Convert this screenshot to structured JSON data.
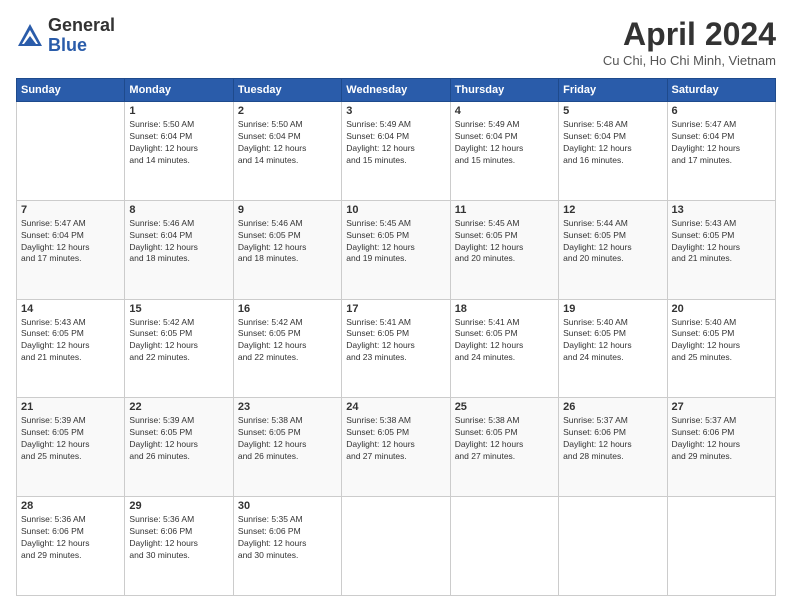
{
  "logo": {
    "general": "General",
    "blue": "Blue"
  },
  "title": "April 2024",
  "location": "Cu Chi, Ho Chi Minh, Vietnam",
  "weekdays": [
    "Sunday",
    "Monday",
    "Tuesday",
    "Wednesday",
    "Thursday",
    "Friday",
    "Saturday"
  ],
  "weeks": [
    [
      {
        "day": "",
        "info": ""
      },
      {
        "day": "1",
        "info": "Sunrise: 5:50 AM\nSunset: 6:04 PM\nDaylight: 12 hours\nand 14 minutes."
      },
      {
        "day": "2",
        "info": "Sunrise: 5:50 AM\nSunset: 6:04 PM\nDaylight: 12 hours\nand 14 minutes."
      },
      {
        "day": "3",
        "info": "Sunrise: 5:49 AM\nSunset: 6:04 PM\nDaylight: 12 hours\nand 15 minutes."
      },
      {
        "day": "4",
        "info": "Sunrise: 5:49 AM\nSunset: 6:04 PM\nDaylight: 12 hours\nand 15 minutes."
      },
      {
        "day": "5",
        "info": "Sunrise: 5:48 AM\nSunset: 6:04 PM\nDaylight: 12 hours\nand 16 minutes."
      },
      {
        "day": "6",
        "info": "Sunrise: 5:47 AM\nSunset: 6:04 PM\nDaylight: 12 hours\nand 17 minutes."
      }
    ],
    [
      {
        "day": "7",
        "info": "Sunrise: 5:47 AM\nSunset: 6:04 PM\nDaylight: 12 hours\nand 17 minutes."
      },
      {
        "day": "8",
        "info": "Sunrise: 5:46 AM\nSunset: 6:04 PM\nDaylight: 12 hours\nand 18 minutes."
      },
      {
        "day": "9",
        "info": "Sunrise: 5:46 AM\nSunset: 6:05 PM\nDaylight: 12 hours\nand 18 minutes."
      },
      {
        "day": "10",
        "info": "Sunrise: 5:45 AM\nSunset: 6:05 PM\nDaylight: 12 hours\nand 19 minutes."
      },
      {
        "day": "11",
        "info": "Sunrise: 5:45 AM\nSunset: 6:05 PM\nDaylight: 12 hours\nand 20 minutes."
      },
      {
        "day": "12",
        "info": "Sunrise: 5:44 AM\nSunset: 6:05 PM\nDaylight: 12 hours\nand 20 minutes."
      },
      {
        "day": "13",
        "info": "Sunrise: 5:43 AM\nSunset: 6:05 PM\nDaylight: 12 hours\nand 21 minutes."
      }
    ],
    [
      {
        "day": "14",
        "info": "Sunrise: 5:43 AM\nSunset: 6:05 PM\nDaylight: 12 hours\nand 21 minutes."
      },
      {
        "day": "15",
        "info": "Sunrise: 5:42 AM\nSunset: 6:05 PM\nDaylight: 12 hours\nand 22 minutes."
      },
      {
        "day": "16",
        "info": "Sunrise: 5:42 AM\nSunset: 6:05 PM\nDaylight: 12 hours\nand 22 minutes."
      },
      {
        "day": "17",
        "info": "Sunrise: 5:41 AM\nSunset: 6:05 PM\nDaylight: 12 hours\nand 23 minutes."
      },
      {
        "day": "18",
        "info": "Sunrise: 5:41 AM\nSunset: 6:05 PM\nDaylight: 12 hours\nand 24 minutes."
      },
      {
        "day": "19",
        "info": "Sunrise: 5:40 AM\nSunset: 6:05 PM\nDaylight: 12 hours\nand 24 minutes."
      },
      {
        "day": "20",
        "info": "Sunrise: 5:40 AM\nSunset: 6:05 PM\nDaylight: 12 hours\nand 25 minutes."
      }
    ],
    [
      {
        "day": "21",
        "info": "Sunrise: 5:39 AM\nSunset: 6:05 PM\nDaylight: 12 hours\nand 25 minutes."
      },
      {
        "day": "22",
        "info": "Sunrise: 5:39 AM\nSunset: 6:05 PM\nDaylight: 12 hours\nand 26 minutes."
      },
      {
        "day": "23",
        "info": "Sunrise: 5:38 AM\nSunset: 6:05 PM\nDaylight: 12 hours\nand 26 minutes."
      },
      {
        "day": "24",
        "info": "Sunrise: 5:38 AM\nSunset: 6:05 PM\nDaylight: 12 hours\nand 27 minutes."
      },
      {
        "day": "25",
        "info": "Sunrise: 5:38 AM\nSunset: 6:05 PM\nDaylight: 12 hours\nand 27 minutes."
      },
      {
        "day": "26",
        "info": "Sunrise: 5:37 AM\nSunset: 6:06 PM\nDaylight: 12 hours\nand 28 minutes."
      },
      {
        "day": "27",
        "info": "Sunrise: 5:37 AM\nSunset: 6:06 PM\nDaylight: 12 hours\nand 29 minutes."
      }
    ],
    [
      {
        "day": "28",
        "info": "Sunrise: 5:36 AM\nSunset: 6:06 PM\nDaylight: 12 hours\nand 29 minutes."
      },
      {
        "day": "29",
        "info": "Sunrise: 5:36 AM\nSunset: 6:06 PM\nDaylight: 12 hours\nand 30 minutes."
      },
      {
        "day": "30",
        "info": "Sunrise: 5:35 AM\nSunset: 6:06 PM\nDaylight: 12 hours\nand 30 minutes."
      },
      {
        "day": "",
        "info": ""
      },
      {
        "day": "",
        "info": ""
      },
      {
        "day": "",
        "info": ""
      },
      {
        "day": "",
        "info": ""
      }
    ]
  ]
}
